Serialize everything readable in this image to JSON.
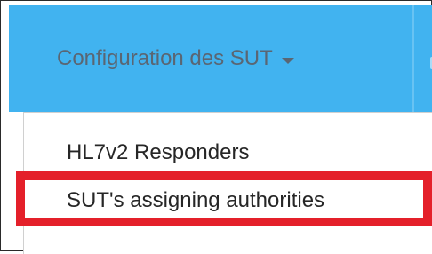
{
  "navbar": {
    "menu_label": "Configuration des SUT",
    "background_color": "#41b3f0"
  },
  "dropdown": {
    "items": [
      {
        "label": "HL7v2 Responders"
      },
      {
        "label": "SUT's assigning authorities"
      }
    ]
  },
  "highlight": {
    "color": "#e4202a",
    "target_item": "SUT's assigning authorities"
  }
}
